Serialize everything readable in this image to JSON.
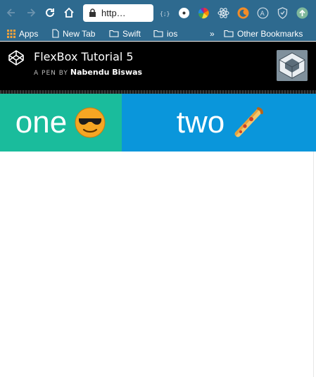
{
  "browser": {
    "url_text": "http…",
    "icons": [
      "back-icon",
      "forward-icon",
      "reload-icon",
      "home-icon",
      "lock-icon",
      "star-icon"
    ],
    "extensions": [
      "bracket-extension-icon",
      "dark-circle-extension-icon",
      "color-wheel-extension-icon",
      "react-extension-icon",
      "moon-extension-icon",
      "accessibility-extension-icon",
      "shield-extension-icon",
      "upload-extension-icon"
    ]
  },
  "bookmarks": {
    "items": [
      {
        "label": "Apps",
        "icon": "apps-grid-icon"
      },
      {
        "label": "New Tab",
        "icon": "page-icon"
      },
      {
        "label": "Swift",
        "icon": "folder-icon"
      },
      {
        "label": "ios",
        "icon": "folder-icon"
      }
    ],
    "overflow": "»",
    "other": "Other Bookmarks"
  },
  "pen": {
    "title": "FlexBox Tutorial 5",
    "byline": "A PEN BY",
    "author": "Nabendu Biswas"
  },
  "boxes": [
    {
      "label": "one",
      "icon": "sunglasses-emoji-icon",
      "color": "#1abc9c"
    },
    {
      "label": "two",
      "icon": "pizza-emoji-icon",
      "color": "#0a96db"
    }
  ]
}
